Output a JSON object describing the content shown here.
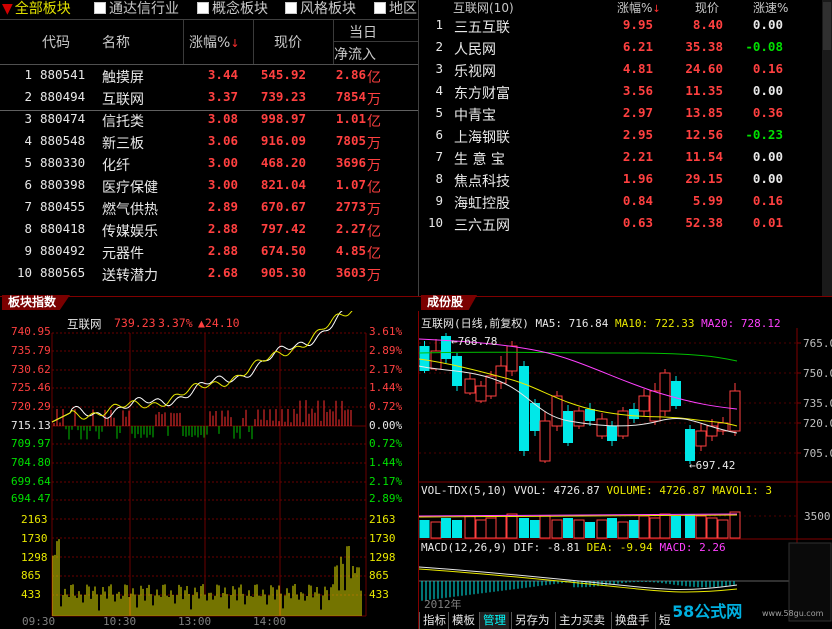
{
  "sector_tabs": [
    {
      "label": "全部板块",
      "active": true
    },
    {
      "label": "通达信行业",
      "active": false
    },
    {
      "label": "概念板块",
      "active": false
    },
    {
      "label": "风格板块",
      "active": false
    },
    {
      "label": "地区",
      "active": false
    }
  ],
  "sector_table": {
    "headers": {
      "code": "代码",
      "name": "名称",
      "change": "涨幅%",
      "price": "现价",
      "day": "当日",
      "flow": "净流入"
    },
    "rows": [
      {
        "no": "1",
        "code": "880541",
        "name": "触摸屏",
        "change": "3.44",
        "price": "545.92",
        "flow": "2.86",
        "unit": "亿"
      },
      {
        "no": "2",
        "code": "880494",
        "name": "互联网",
        "change": "3.37",
        "price": "739.23",
        "flow": "7854",
        "unit": "万"
      },
      {
        "no": "3",
        "code": "880474",
        "name": "信托类",
        "change": "3.08",
        "price": "998.97",
        "flow": "1.01",
        "unit": "亿"
      },
      {
        "no": "4",
        "code": "880548",
        "name": "新三板",
        "change": "3.06",
        "price": "916.09",
        "flow": "7805",
        "unit": "万"
      },
      {
        "no": "5",
        "code": "880330",
        "name": "化纤",
        "change": "3.00",
        "price": "468.20",
        "flow": "3696",
        "unit": "万"
      },
      {
        "no": "6",
        "code": "880398",
        "name": "医疗保健",
        "change": "3.00",
        "price": "821.04",
        "flow": "1.07",
        "unit": "亿"
      },
      {
        "no": "7",
        "code": "880455",
        "name": "燃气供热",
        "change": "2.89",
        "price": "670.67",
        "flow": "2773",
        "unit": "万"
      },
      {
        "no": "8",
        "code": "880418",
        "name": "传媒娱乐",
        "change": "2.88",
        "price": "797.42",
        "flow": "2.27",
        "unit": "亿"
      },
      {
        "no": "9",
        "code": "880492",
        "name": "元器件",
        "change": "2.88",
        "price": "674.50",
        "flow": "4.85",
        "unit": "亿"
      },
      {
        "no": "10",
        "code": "880565",
        "name": "送转潜力",
        "change": "2.68",
        "price": "905.30",
        "flow": "3603",
        "unit": "万"
      }
    ]
  },
  "stock_table": {
    "title": "互联网(10)",
    "headers": {
      "change": "涨幅%",
      "price": "现价",
      "speed": "涨速%"
    },
    "rows": [
      {
        "no": "1",
        "name": "三五互联",
        "change": "9.95",
        "price": "8.40",
        "speed": "0.00"
      },
      {
        "no": "2",
        "name": "人民网",
        "change": "6.21",
        "price": "35.38",
        "speed": "-0.08"
      },
      {
        "no": "3",
        "name": "乐视网",
        "change": "4.81",
        "price": "24.60",
        "speed": "0.16"
      },
      {
        "no": "4",
        "name": "东方财富",
        "change": "3.56",
        "price": "11.35",
        "speed": "0.00"
      },
      {
        "no": "5",
        "name": "中青宝",
        "change": "2.97",
        "price": "13.85",
        "speed": "0.36"
      },
      {
        "no": "6",
        "name": "上海钢联",
        "change": "2.95",
        "price": "12.56",
        "speed": "-0.23"
      },
      {
        "no": "7",
        "name": "生 意 宝",
        "change": "2.21",
        "price": "11.54",
        "speed": "0.00"
      },
      {
        "no": "8",
        "name": "焦点科技",
        "change": "1.96",
        "price": "29.15",
        "speed": "0.00"
      },
      {
        "no": "9",
        "name": "海虹控股",
        "change": "0.84",
        "price": "5.99",
        "speed": "0.16"
      },
      {
        "no": "10",
        "name": "三六五网",
        "change": "0.63",
        "price": "52.38",
        "speed": "0.01"
      }
    ]
  },
  "sector_index_panel": {
    "tag": "板块指数",
    "name": "互联网",
    "price": "739.23",
    "pct": "3.37%",
    "delta": "▲24.10",
    "y_left": [
      "740.95",
      "735.79",
      "730.62",
      "725.46",
      "720.29",
      "715.13",
      "709.97",
      "704.80",
      "699.64",
      "694.47"
    ],
    "y_right": [
      "3.61%",
      "2.89%",
      "2.17%",
      "1.44%",
      "0.72%",
      "0.00%",
      "0.72%",
      "1.44%",
      "2.17%",
      "2.89%"
    ],
    "vol_labels": [
      "2163",
      "1730",
      "1298",
      "865",
      "433"
    ],
    "time_labels": [
      "09:30",
      "10:30",
      "13:00",
      "14:00"
    ]
  },
  "component_panel": {
    "tag": "成份股",
    "kline_title": "互联网(日线,前复权)",
    "ma5": "MA5: 716.84",
    "ma10": "MA10: 722.33",
    "ma20": "MA20: 728.12",
    "high_mark": "768.78",
    "low_mark": "697.42",
    "y_labels": [
      "765.00",
      "750.00",
      "735.00",
      "720.00",
      "705.00"
    ],
    "vol_title": "VOL-TDX(5,10)",
    "vol_value": "VVOL: 4726.87",
    "volume_value": "VOLUME: 4726.87",
    "mavol": "MAVOL1: 3",
    "vol_axis": "3500",
    "macd_title": "MACD(12,26,9)",
    "dif": "DIF: -8.81",
    "dea": "DEA: -9.94",
    "macd": "MACD: 2.26",
    "year": "2012年"
  },
  "bottom_tabs": [
    "指标",
    "模板",
    "管理",
    "另存为",
    "主力买卖",
    "换盘手",
    "短"
  ],
  "watermark": "58公式网",
  "watermark_url": "www.58gu.com",
  "colors": {
    "up": "#ff4040",
    "down": "#00e000",
    "neutral": "#e8e8e8",
    "accent": "#e8e800",
    "cyan": "#00ffff"
  }
}
